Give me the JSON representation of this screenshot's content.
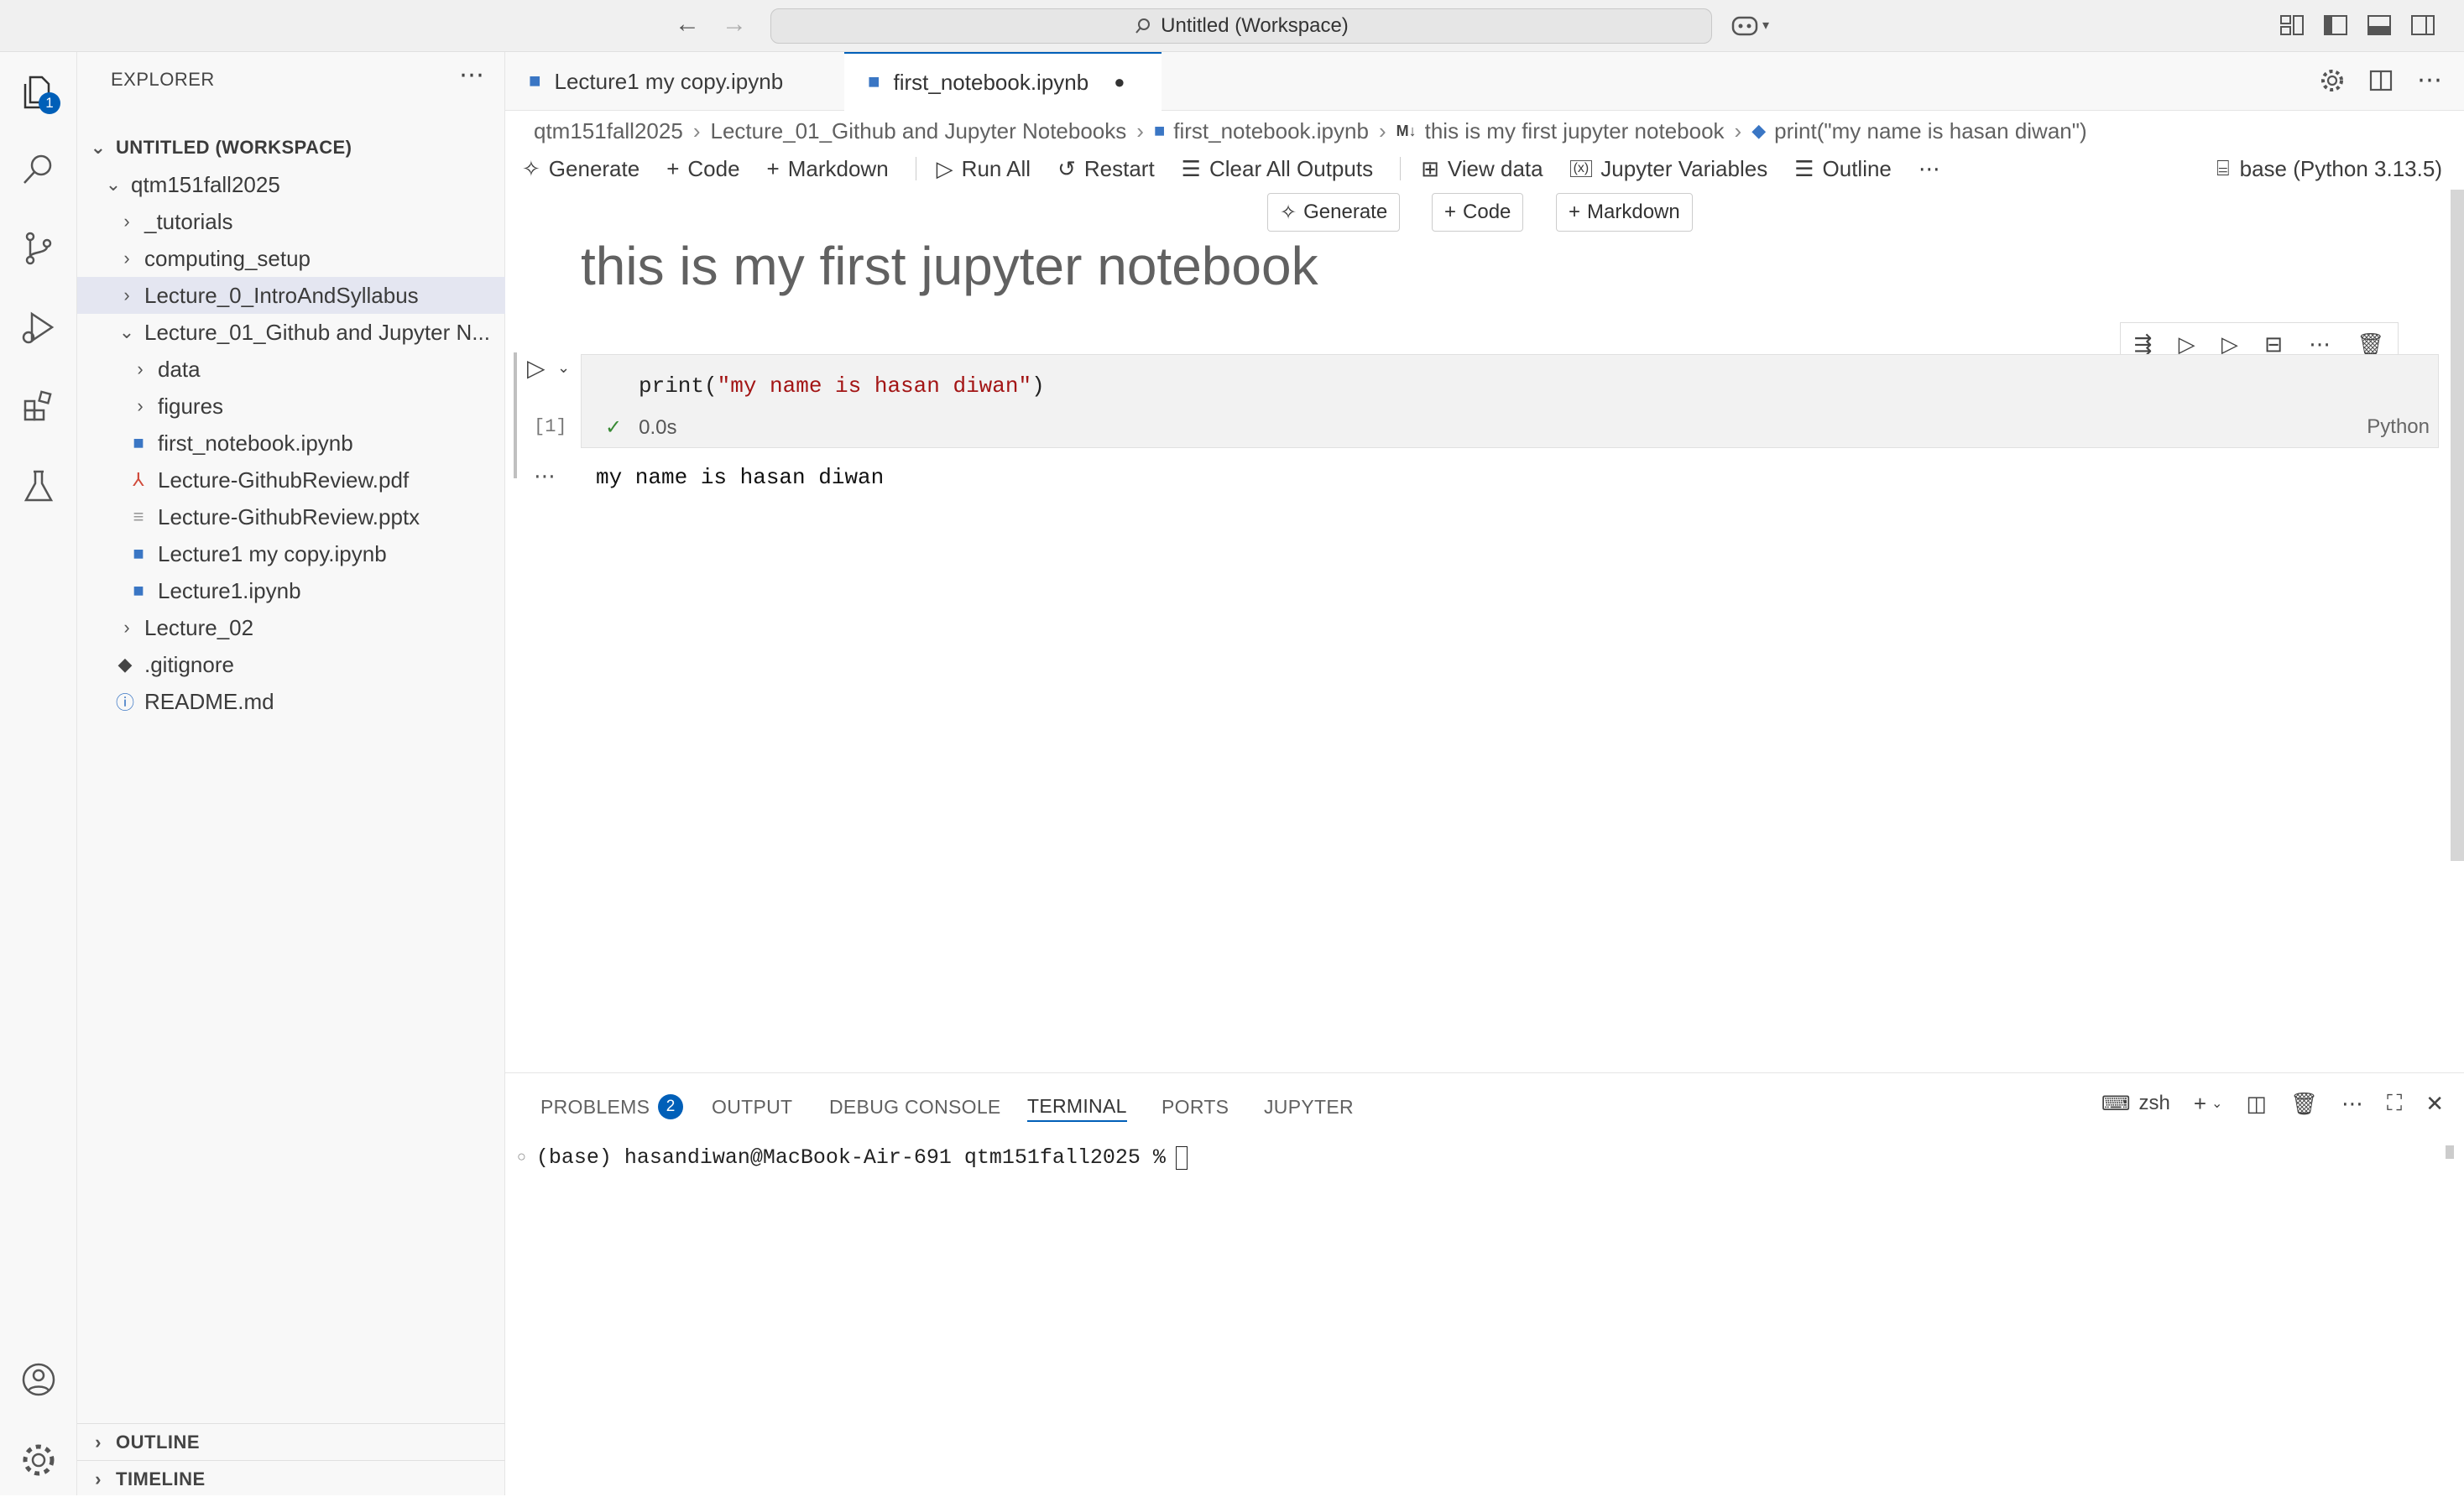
{
  "titlebar": {
    "search_text": "Untitled (Workspace)"
  },
  "activity": {
    "explorer_badge": "1"
  },
  "explorer": {
    "title": "EXPLORER",
    "workspace": "UNTITLED (WORKSPACE)",
    "items": [
      {
        "label": "qtm151fall2025"
      },
      {
        "label": "_tutorials"
      },
      {
        "label": "computing_setup"
      },
      {
        "label": "Lecture_0_IntroAndSyllabus"
      },
      {
        "label": "Lecture_01_Github and Jupyter N..."
      },
      {
        "label": "data"
      },
      {
        "label": "figures"
      },
      {
        "label": "first_notebook.ipynb"
      },
      {
        "label": "Lecture-GithubReview.pdf"
      },
      {
        "label": "Lecture-GithubReview.pptx"
      },
      {
        "label": "Lecture1 my copy.ipynb"
      },
      {
        "label": "Lecture1.ipynb"
      },
      {
        "label": "Lecture_02"
      },
      {
        "label": ".gitignore"
      },
      {
        "label": "README.md"
      }
    ],
    "outline": "OUTLINE",
    "timeline": "TIMELINE"
  },
  "tabs": [
    {
      "label": "Lecture1 my copy.ipynb"
    },
    {
      "label": "first_notebook.ipynb"
    }
  ],
  "breadcrumb": [
    "qtm151fall2025",
    "Lecture_01_Github and Jupyter Notebooks",
    "first_notebook.ipynb",
    "this is my first jupyter notebook",
    "print(\"my name is hasan diwan\")"
  ],
  "toolbar": {
    "generate": "Generate",
    "code": "Code",
    "markdown": "Markdown",
    "run_all": "Run All",
    "restart": "Restart",
    "clear": "Clear All Outputs",
    "view_data": "View data",
    "variables": "Jupyter Variables",
    "outline": "Outline",
    "kernel": "base (Python 3.13.5)"
  },
  "insert": {
    "generate": "Generate",
    "code": "Code",
    "markdown": "Markdown"
  },
  "notebook": {
    "heading": "this is my first jupyter notebook",
    "code_fn": "print(",
    "code_str": "\"my name is hasan diwan\"",
    "code_end": ")",
    "exec_count": "[1]",
    "duration": "0.0s",
    "language": "Python",
    "output": "my name is hasan diwan"
  },
  "panel": {
    "tabs": [
      "PROBLEMS",
      "OUTPUT",
      "DEBUG CONSOLE",
      "TERMINAL",
      "PORTS",
      "JUPYTER"
    ],
    "problems_count": "2",
    "shell": "zsh",
    "prompt": "(base) hasandiwan@MacBook-Air-691 qtm151fall2025 %"
  }
}
